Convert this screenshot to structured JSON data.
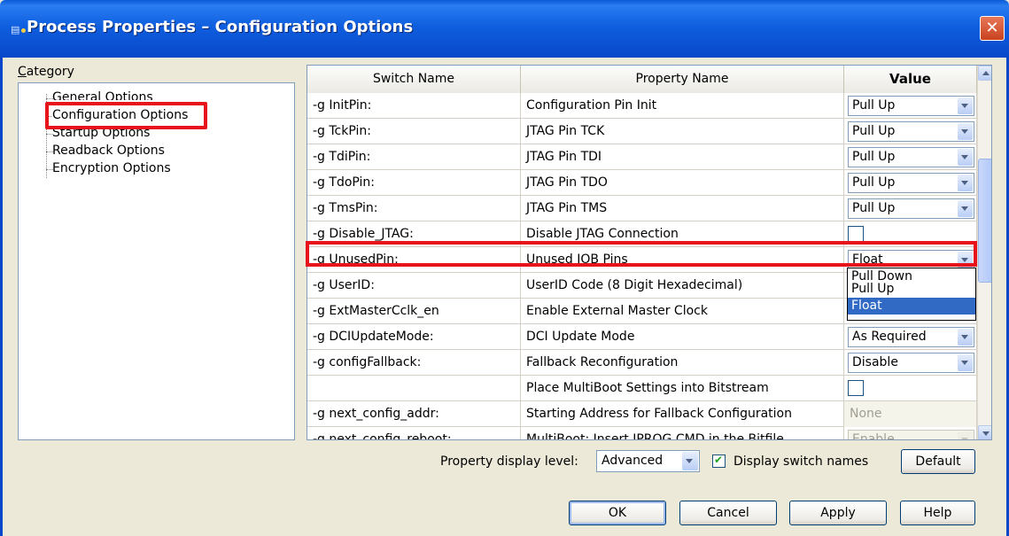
{
  "window": {
    "title": "Process Properties – Configuration Options",
    "close_glyph": "✕"
  },
  "category": {
    "label_prefix": "C",
    "label_rest": "ategory",
    "items": [
      {
        "label": "General Options"
      },
      {
        "label": "Configuration Options",
        "selected": true
      },
      {
        "label": "Startup Options"
      },
      {
        "label": "Readback Options"
      },
      {
        "label": "Encryption Options"
      }
    ]
  },
  "grid": {
    "headers": {
      "switch": "Switch Name",
      "property": "Property Name",
      "value": "Value"
    },
    "rows": [
      {
        "switch": "-g InitPin:",
        "property": "Configuration Pin Init",
        "type": "combo",
        "value": "Pull Up"
      },
      {
        "switch": "-g TckPin:",
        "property": "JTAG Pin TCK",
        "type": "combo",
        "value": "Pull Up"
      },
      {
        "switch": "-g TdiPin:",
        "property": "JTAG Pin TDI",
        "type": "combo",
        "value": "Pull Up"
      },
      {
        "switch": "-g TdoPin:",
        "property": "JTAG Pin TDO",
        "type": "combo",
        "value": "Pull Up"
      },
      {
        "switch": "-g TmsPin:",
        "property": "JTAG Pin TMS",
        "type": "combo",
        "value": "Pull Up"
      },
      {
        "switch": "-g Disable_JTAG:",
        "property": "Disable JTAG Connection",
        "type": "checkbox",
        "value": ""
      },
      {
        "switch": "-g UnusedPin:",
        "property": "Unused IOB Pins",
        "type": "combo",
        "value": "Float"
      },
      {
        "switch": "-g UserID:",
        "property": "UserID Code (8 Digit Hexadecimal)",
        "type": "none",
        "value": ""
      },
      {
        "switch": "-g ExtMasterCclk_en",
        "property": "Enable External Master Clock",
        "type": "none",
        "value": ""
      },
      {
        "switch": "-g DCIUpdateMode:",
        "property": "DCI Update Mode",
        "type": "combo",
        "value": "As Required"
      },
      {
        "switch": "-g configFallback:",
        "property": "Fallback Reconfiguration",
        "type": "combo",
        "value": "Disable"
      },
      {
        "switch": "",
        "property": "Place MultiBoot Settings into Bitstream",
        "type": "checkbox",
        "value": ""
      },
      {
        "switch": "-g next_config_addr:",
        "property": "Starting Address for Fallback Configuration",
        "type": "text-disabled",
        "value": "None"
      },
      {
        "switch": "-g next_config_reboot:",
        "property": "MultiBoot: Insert IPROG CMD in the Bitfile",
        "type": "combo-disabled",
        "value": "Enable"
      }
    ],
    "dropdown_options": [
      "Pull Down",
      "Pull Up",
      "Float"
    ],
    "dropdown_selected": "Float"
  },
  "footer": {
    "level_label": "Property display level:",
    "level_value": "Advanced",
    "display_switch_label": "Display switch names",
    "display_switch_checked": true,
    "default_button": "Default",
    "ok_button": "OK",
    "cancel_button": "Cancel",
    "apply_button": "Apply",
    "help_button": "Help"
  },
  "colors": {
    "highlight_red": "#e8141c",
    "selection_blue": "#316ac5",
    "title_blue": "#0847c8"
  }
}
